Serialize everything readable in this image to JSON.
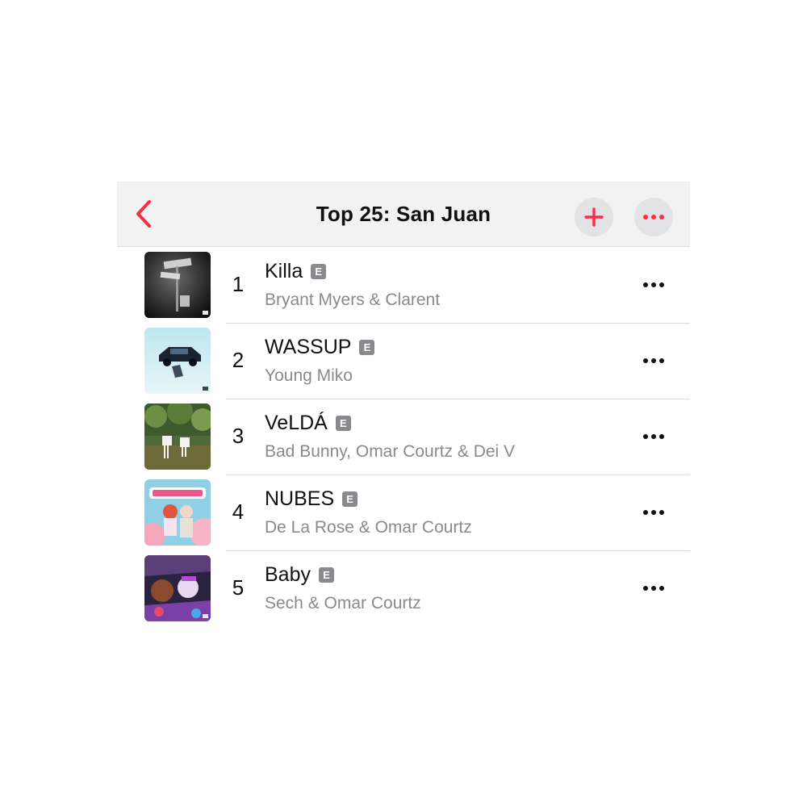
{
  "header": {
    "title": "Top 25: San Juan",
    "back_icon": "chevron-left-icon",
    "add_icon": "plus-icon",
    "more_icon": "ellipsis-icon",
    "accent_color": "#fa2d48"
  },
  "songs": [
    {
      "rank": "1",
      "title": "Killa",
      "explicit": "E",
      "artist": "Bryant Myers & Clarent"
    },
    {
      "rank": "2",
      "title": "WASSUP",
      "explicit": "E",
      "artist": "Young Miko"
    },
    {
      "rank": "3",
      "title": "VeLDÁ",
      "explicit": "E",
      "artist": "Bad Bunny, Omar Courtz & Dei V"
    },
    {
      "rank": "4",
      "title": "NUBES",
      "explicit": "E",
      "artist": "De La Rose & Omar Courtz"
    },
    {
      "rank": "5",
      "title": "Baby",
      "explicit": "E",
      "artist": "Sech & Omar Courtz"
    }
  ]
}
